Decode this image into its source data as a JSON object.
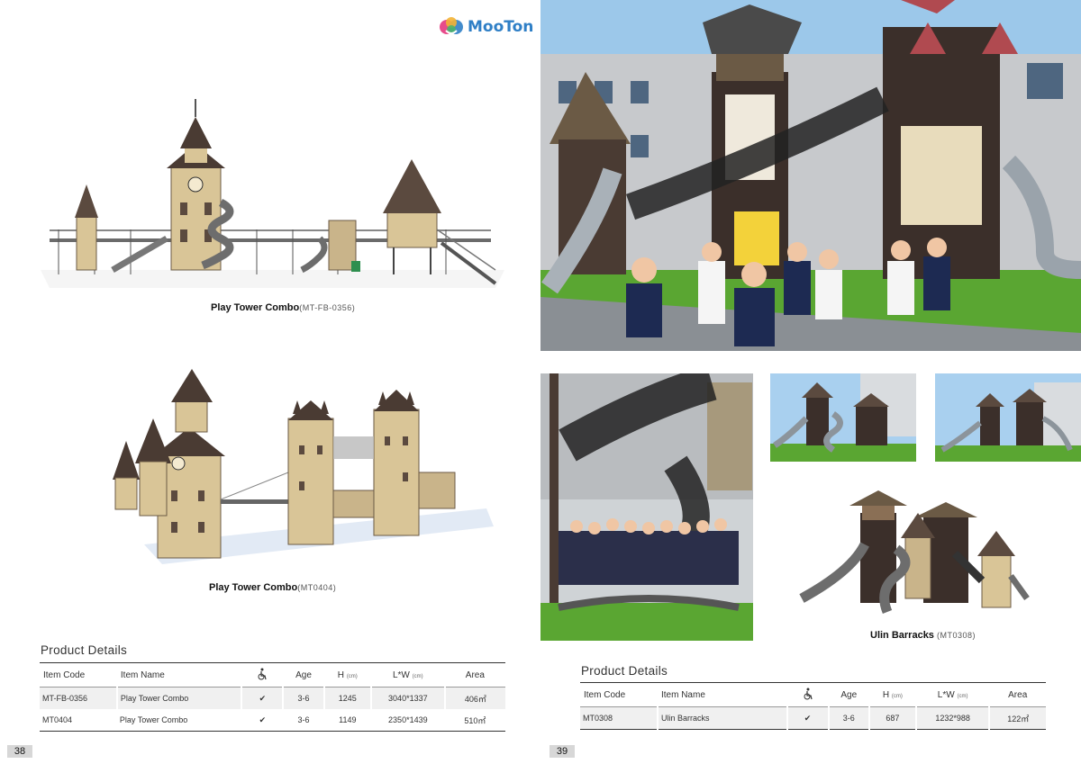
{
  "brand": {
    "logo_text": "MooTon"
  },
  "left_page": {
    "products": [
      {
        "name": "Play Tower Combo",
        "code": "(MT-FB-0356)"
      },
      {
        "name": "Play Tower Combo",
        "code": "(MT0404)"
      }
    ],
    "details_title": "Product Details",
    "table": {
      "headers": {
        "item_code": "Item Code",
        "item_name": "Item Name",
        "access_icon": "wheelchair-icon",
        "age": "Age",
        "h": "H",
        "h_unit": "(cm)",
        "lw": "L*W",
        "lw_unit": "(cm)",
        "area": "Area"
      },
      "rows": [
        {
          "item_code": "MT-FB-0356",
          "item_name": "Play Tower Combo",
          "check": "✔",
          "age": "3-6",
          "h": "1245",
          "lw": "3040*1337",
          "area": "406㎡"
        },
        {
          "item_code": "MT0404",
          "item_name": "Play Tower Combo",
          "check": "✔",
          "age": "3-6",
          "h": "1149",
          "lw": "2350*1439",
          "area": "510㎡"
        }
      ]
    },
    "page_number": "38"
  },
  "right_page": {
    "product": {
      "name": "Ulin Barracks",
      "code": "(MT0308)"
    },
    "details_title": "Product Details",
    "table": {
      "headers": {
        "item_code": "Item Code",
        "item_name": "Item Name",
        "access_icon": "wheelchair-icon",
        "age": "Age",
        "h": "H",
        "h_unit": "(cm)",
        "lw": "L*W",
        "lw_unit": "(cm)",
        "area": "Area"
      },
      "rows": [
        {
          "item_code": "MT0308",
          "item_name": "Ulin Barracks",
          "check": "✔",
          "age": "3-6",
          "h": "687",
          "lw": "1232*988",
          "area": "122㎡"
        }
      ]
    },
    "page_number": "39"
  },
  "colors": {
    "brand_blue": "#2f7fc6",
    "roof_brown": "#5b4a3f",
    "wall_tan": "#d9c597",
    "turf_green": "#5aa632",
    "sky_blue": "#9cc8ea"
  }
}
